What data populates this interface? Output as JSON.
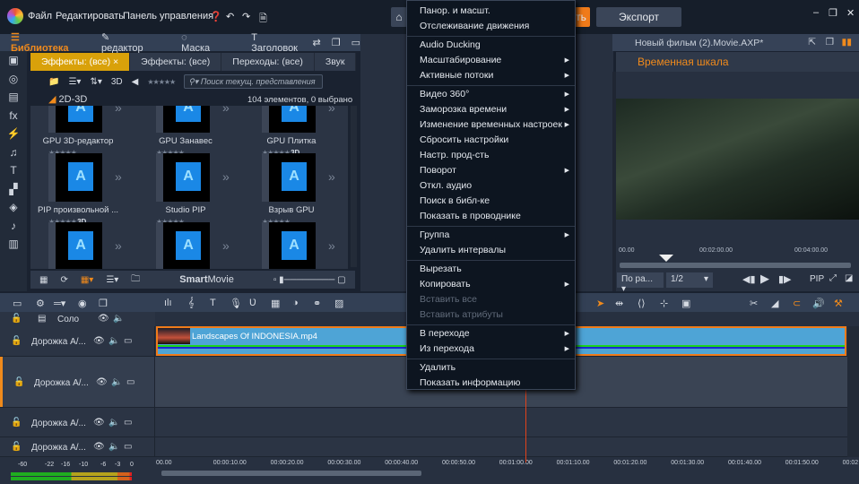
{
  "menubar": {
    "items": [
      "Файл",
      "Редактировать",
      "Панель управления"
    ],
    "export": "Экспорт",
    "import_partial": "ть"
  },
  "library": {
    "tabs": [
      "Библиотека",
      "редактор",
      "Маска",
      "Заголовок"
    ],
    "subtabs": [
      "Эффекты: (все)",
      "Эффекты: (все)",
      "Переходы: (все)",
      "Звук"
    ],
    "toolbar": {
      "three_d": "3D",
      "search_placeholder": "Поиск текущ. представления"
    },
    "folder": "2D-3D",
    "count": "104 элементов, 0 выбрано",
    "items": [
      {
        "name": "GPU 3D-редактор",
        "badge": ""
      },
      {
        "name": "GPU Занавес",
        "badge": ""
      },
      {
        "name": "GPU Плитка",
        "badge": "3D"
      },
      {
        "name": "PIP произвольной ...",
        "badge": "3D"
      },
      {
        "name": "Studio PIP",
        "badge": ""
      },
      {
        "name": "Взрыв GPU",
        "badge": ""
      }
    ],
    "bottom": {
      "smart": "Smart",
      "movie": "Movie"
    }
  },
  "preview": {
    "title": "Новый фильм (2).Movie.AXP*",
    "tab": "Временная шкала",
    "ruler": [
      "00.00",
      "00:02:00.00",
      "00:04:00.00"
    ],
    "fit": "По ра...",
    "ratio": "1/2",
    "pip": "PIP",
    "playhead_fraction": 0.2
  },
  "timeline": {
    "solo": "Соло",
    "tracks": [
      "Дорожка А/...",
      "Дорожка А/...",
      "Дорожка А/...",
      "Дорожка А/..."
    ],
    "clip": "Landscapes Of INDONESIA.mp4",
    "ruler": [
      "00.00",
      "00:00:10.00",
      "00:00:20.00",
      "00:00:30.00",
      "00:00:40.00",
      "00:00:50.00",
      "00:01:00.00",
      "00:01:10.00",
      "00:01:20.00",
      "00:01:30.00",
      "00:01:40.00",
      "00:01:50.00",
      "00:02"
    ],
    "vu": [
      "-60",
      "-22",
      "-16",
      "-10",
      "-6",
      "-3",
      "0"
    ]
  },
  "context_menu": [
    {
      "label": "Панор. и масшт."
    },
    {
      "label": "Отслеживание движения"
    },
    {
      "sep": true
    },
    {
      "label": "Audio Ducking"
    },
    {
      "label": "Масштабирование",
      "sub": true
    },
    {
      "label": "Активные потоки",
      "sub": true
    },
    {
      "sep": true
    },
    {
      "label": "Видео 360°",
      "sub": true
    },
    {
      "label": "Заморозка времени",
      "sub": true
    },
    {
      "label": "Изменение временных настроек",
      "sub": true
    },
    {
      "label": "Сбросить настройки"
    },
    {
      "label": "Настр. прод-сть"
    },
    {
      "label": "Поворот",
      "sub": true
    },
    {
      "label": "Откл. аудио"
    },
    {
      "label": "Поиск в библ-ке"
    },
    {
      "label": "Показать в проводнике"
    },
    {
      "sep": true
    },
    {
      "label": "Группа",
      "sub": true
    },
    {
      "label": "Удалить интервалы"
    },
    {
      "sep": true
    },
    {
      "label": "Вырезать"
    },
    {
      "label": "Копировать",
      "sub": true
    },
    {
      "label": "Вставить все",
      "disabled": true
    },
    {
      "label": "Вставить атрибуты",
      "disabled": true
    },
    {
      "sep": true
    },
    {
      "label": "В переходе",
      "sub": true
    },
    {
      "label": "Из перехода",
      "sub": true
    },
    {
      "sep": true
    },
    {
      "label": "Удалить"
    },
    {
      "label": "Показать информацию"
    }
  ],
  "colors": {
    "accent": "#f08a1c",
    "tab_active": "#d9a10a",
    "clip": "#4ea4d6"
  }
}
